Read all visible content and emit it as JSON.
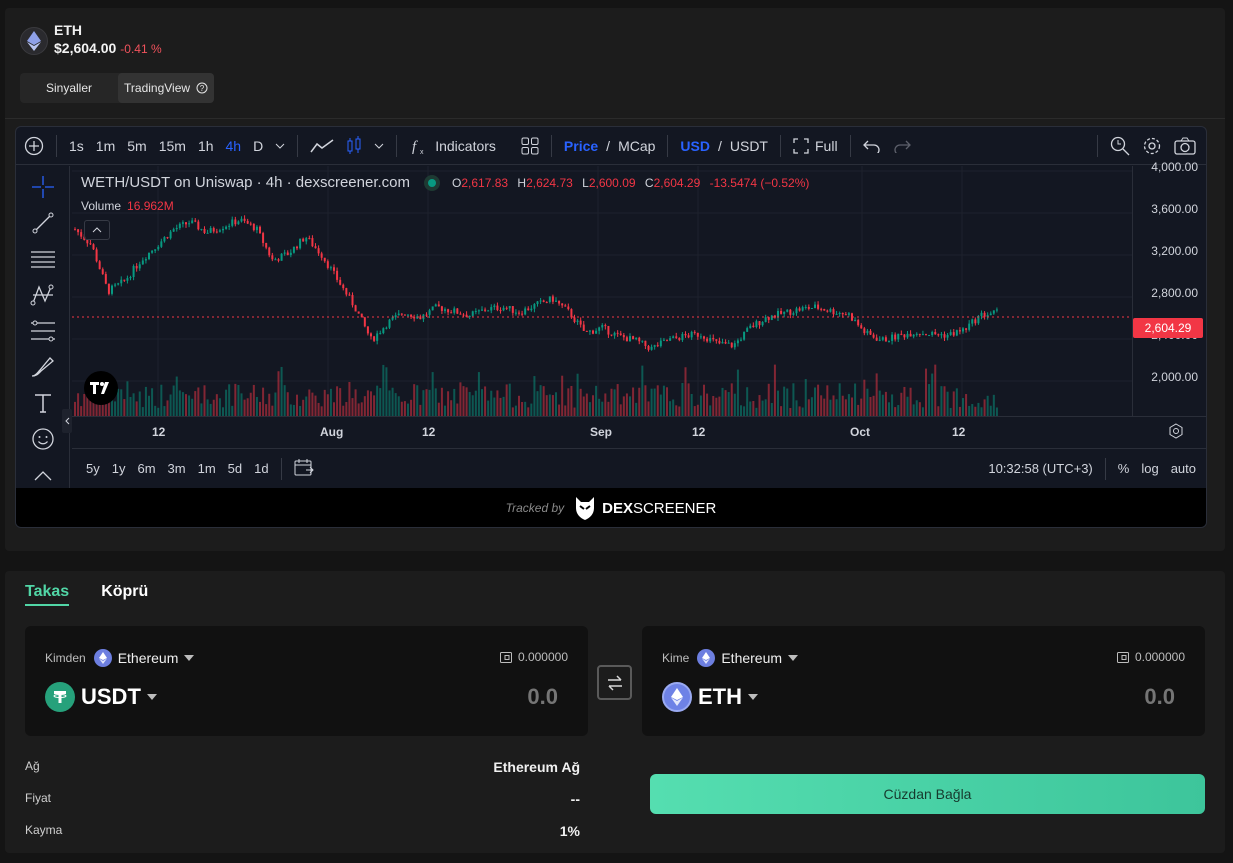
{
  "token": {
    "symbol": "ETH",
    "price": "$2,604.00",
    "change": "-0.41 %"
  },
  "view_tabs": {
    "signals": "Sinyaller",
    "tradingview": "TradingView"
  },
  "toolbar": {
    "intervals": [
      "1s",
      "1m",
      "5m",
      "15m",
      "1h",
      "4h",
      "D"
    ],
    "active_interval": "4h",
    "indicators": "Indicators",
    "price": "Price",
    "slash1": "/",
    "mcap": "MCap",
    "usd": "USD",
    "slash2": "/",
    "usdt": "USDT",
    "full": "Full"
  },
  "legend": {
    "pair": "WETH/USDT on Uniswap · 4h · dexscreener.com",
    "o_label": "O",
    "o": "2,617.83",
    "h_label": "H",
    "h": "2,624.73",
    "l_label": "L",
    "l": "2,600.09",
    "c_label": "C",
    "c": "2,604.29",
    "chg": "-13.5474 (−0.52%)",
    "volume_label": "Volume",
    "volume": "16.962M"
  },
  "chart_data": {
    "type": "candlestick",
    "title": "WETH/USDT on Uniswap · 4h · dexscreener.com",
    "y_ticks": [
      "4,000.00",
      "3,600.00",
      "3,200.00",
      "2,800.00",
      "2,400.00",
      "2,000.00"
    ],
    "x_ticks": [
      "12",
      "Aug",
      "12",
      "Sep",
      "12",
      "Oct",
      "12"
    ],
    "ylim": [
      1650,
      4060
    ],
    "last_price": "2,604.29",
    "series": [
      {
        "name": "close",
        "values": [
          3450,
          3300,
          2850,
          2950,
          3150,
          3300,
          3450,
          3520,
          3420,
          3480,
          3540,
          3460,
          3150,
          3220,
          3380,
          3200,
          2950,
          2700,
          2380,
          2550,
          2650,
          2600,
          2700,
          2660,
          2620,
          2680,
          2700,
          2650,
          2720,
          2780,
          2650,
          2450,
          2500,
          2420,
          2380,
          2300,
          2380,
          2420,
          2440,
          2350,
          2330,
          2500,
          2600,
          2640,
          2680,
          2700,
          2660,
          2630,
          2450,
          2380,
          2420,
          2460,
          2440,
          2430,
          2480,
          2620,
          2650
        ]
      }
    ],
    "grid": true,
    "legend": "top-left"
  },
  "x_axis": {
    "labels": [
      "12",
      "Aug",
      "12",
      "Sep",
      "12",
      "Oct",
      "12"
    ]
  },
  "range_buttons": [
    "5y",
    "1y",
    "6m",
    "3m",
    "1m",
    "5d",
    "1d"
  ],
  "bottom_bar": {
    "time": "10:32:58 (UTC+3)",
    "percent": "%",
    "log": "log",
    "auto": "auto"
  },
  "tracked": {
    "prefix": "Tracked by",
    "brand_bold": "DEX",
    "brand_light": "SCREENER"
  },
  "swap": {
    "tabs": [
      "Takas",
      "Köprü"
    ],
    "from": {
      "label": "Kimden",
      "network": "Ethereum",
      "balance": "0.000000",
      "asset": "USDT",
      "amount": "0.0"
    },
    "to": {
      "label": "Kime",
      "network": "Ethereum",
      "balance": "0.000000",
      "asset": "ETH",
      "amount": "0.0"
    },
    "info": [
      {
        "label": "Ağ",
        "value": "Ethereum Ağ"
      },
      {
        "label": "Fiyat",
        "value": "--"
      },
      {
        "label": "Kayma",
        "value": "1%"
      }
    ],
    "connect": "Cüzdan Bağla"
  },
  "colors": {
    "accent": "#51d6a6",
    "up": "#089981",
    "down": "#f23645",
    "blue": "#2962ff"
  }
}
